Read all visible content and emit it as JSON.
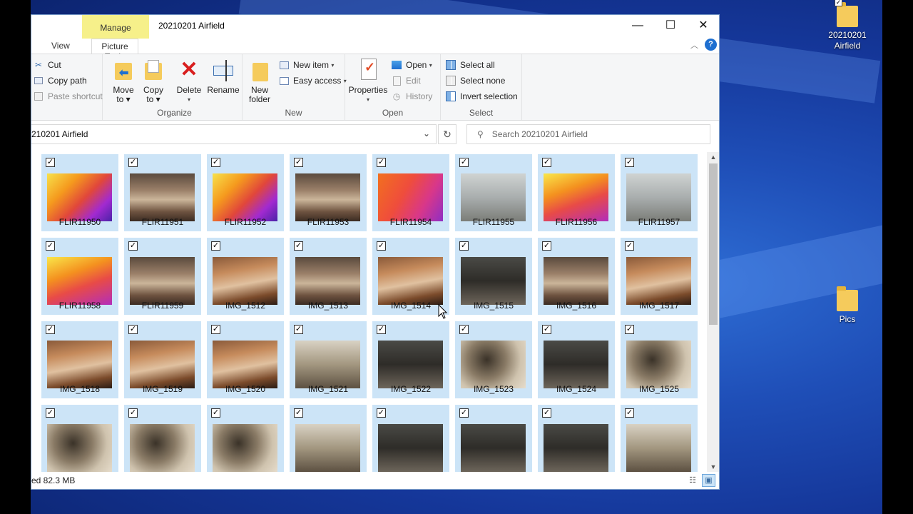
{
  "window": {
    "title": "20210201 Airfield",
    "manage_tab": "Manage",
    "tabs": [
      "View",
      "Picture Tools"
    ],
    "controls": {
      "minimize": "—",
      "maximize": "☐",
      "close": "✕"
    }
  },
  "ribbon": {
    "clipboard": {
      "cut": "Cut",
      "copy_path": "Copy path",
      "paste_shortcut": "Paste shortcut"
    },
    "organize": {
      "label": "Organize",
      "move_to": [
        "Move",
        "to ▾"
      ],
      "copy_to": [
        "Copy",
        "to ▾"
      ],
      "delete": [
        "Delete",
        "▾"
      ],
      "rename": "Rename"
    },
    "new": {
      "label": "New",
      "new_folder": [
        "New",
        "folder"
      ],
      "new_item": "New item",
      "easy_access": "Easy access"
    },
    "open": {
      "label": "Open",
      "properties": [
        "Properties",
        "▾"
      ],
      "open": "Open",
      "edit": "Edit",
      "history": "History"
    },
    "select": {
      "label": "Select",
      "select_all": "Select all",
      "select_none": "Select none",
      "invert_selection": "Invert selection"
    }
  },
  "address": {
    "path": "210201 Airfield",
    "search_placeholder": "Search 20210201 Airfield"
  },
  "files": [
    {
      "name": "FLIR11950",
      "kind": "thermal"
    },
    {
      "name": "FLIR11951",
      "kind": "wood"
    },
    {
      "name": "FLIR11952",
      "kind": "thermal"
    },
    {
      "name": "FLIR11953",
      "kind": "wood"
    },
    {
      "name": "FLIR11954",
      "kind": "thermal3"
    },
    {
      "name": "FLIR11955",
      "kind": "wall"
    },
    {
      "name": "FLIR11956",
      "kind": "thermal2"
    },
    {
      "name": "FLIR11957",
      "kind": "wall"
    },
    {
      "name": "FLIR11958",
      "kind": "thermal2"
    },
    {
      "name": "FLIR11959",
      "kind": "wood"
    },
    {
      "name": "IMG_1512",
      "kind": "wood2"
    },
    {
      "name": "IMG_1513",
      "kind": "wood"
    },
    {
      "name": "IMG_1514",
      "kind": "wood2"
    },
    {
      "name": "IMG_1515",
      "kind": "dark"
    },
    {
      "name": "IMG_1516",
      "kind": "wood"
    },
    {
      "name": "IMG_1517",
      "kind": "wood2"
    },
    {
      "name": "IMG_1518",
      "kind": "wood2"
    },
    {
      "name": "IMG_1519",
      "kind": "wood2"
    },
    {
      "name": "IMG_1520",
      "kind": "wood2"
    },
    {
      "name": "IMG_1521",
      "kind": "room"
    },
    {
      "name": "IMG_1522",
      "kind": "dark"
    },
    {
      "name": "IMG_1523",
      "kind": "mold"
    },
    {
      "name": "IMG_1524",
      "kind": "dark"
    },
    {
      "name": "IMG_1525",
      "kind": "mold"
    },
    {
      "name": "",
      "kind": "mold"
    },
    {
      "name": "",
      "kind": "mold"
    },
    {
      "name": "",
      "kind": "mold"
    },
    {
      "name": "",
      "kind": "room"
    },
    {
      "name": "",
      "kind": "dark"
    },
    {
      "name": "",
      "kind": "dark"
    },
    {
      "name": "",
      "kind": "dark"
    },
    {
      "name": "",
      "kind": "room"
    }
  ],
  "status": {
    "text": "ed  82.3 MB"
  },
  "desktop": {
    "icons": [
      {
        "label": "20210201 Airfield"
      },
      {
        "label": "Pics"
      }
    ]
  },
  "colors": {
    "selection": "#cce4f7",
    "manage_tab": "#f6f08a",
    "desktop": "#1f4fb8"
  }
}
